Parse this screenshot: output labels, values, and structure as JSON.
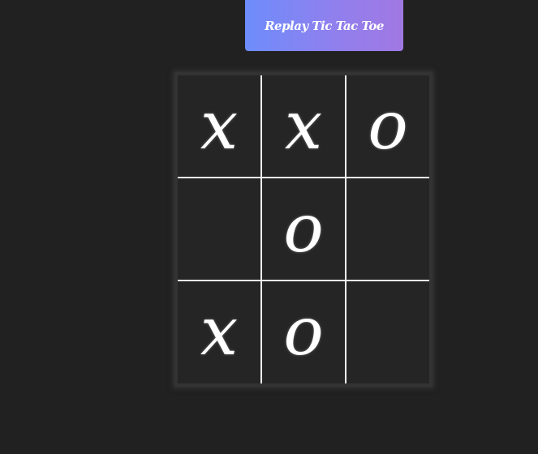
{
  "replay_button": {
    "label": "Replay Tic Tac Toe"
  },
  "board": {
    "cells": [
      [
        "x",
        "x",
        "o"
      ],
      [
        "",
        "o",
        ""
      ],
      [
        "x",
        "o",
        ""
      ]
    ]
  },
  "colors": {
    "background": "#212121",
    "board_background": "#252525",
    "grid_line": "#f2f2f2",
    "mark": "#ffffff",
    "button_gradient_start": "#6d8dfb",
    "button_gradient_end": "#a178e3"
  }
}
